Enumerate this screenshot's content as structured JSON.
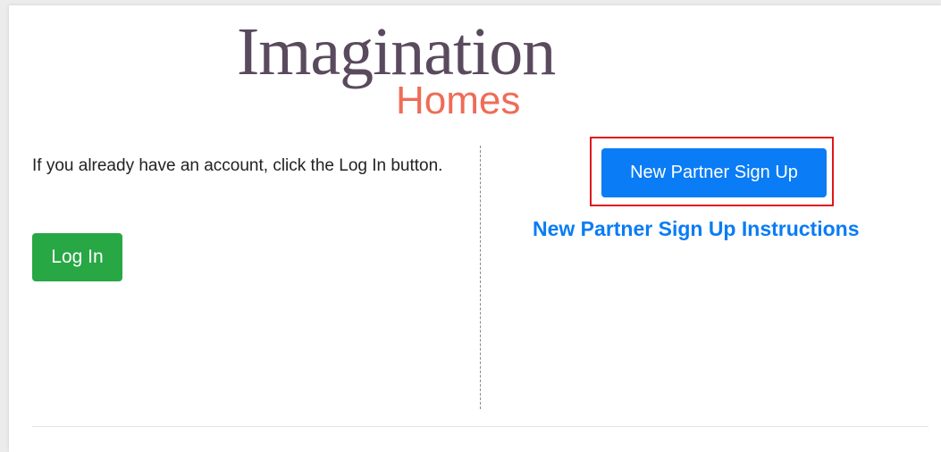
{
  "logo": {
    "line1": "Imagination",
    "line2": "Homes",
    "colors": {
      "line1": "#5a4a5e",
      "line2": "#ef6c57"
    }
  },
  "left": {
    "intro": "If you already have an account, click the Log In button.",
    "login_label": "Log In"
  },
  "right": {
    "signup_label": "New Partner Sign Up",
    "instructions_link": "New Partner Sign Up Instructions"
  },
  "colors": {
    "login_button": "#28a745",
    "signup_button": "#0a7cf5",
    "link": "#0a7cf5",
    "highlight_box": "#e0161e"
  }
}
